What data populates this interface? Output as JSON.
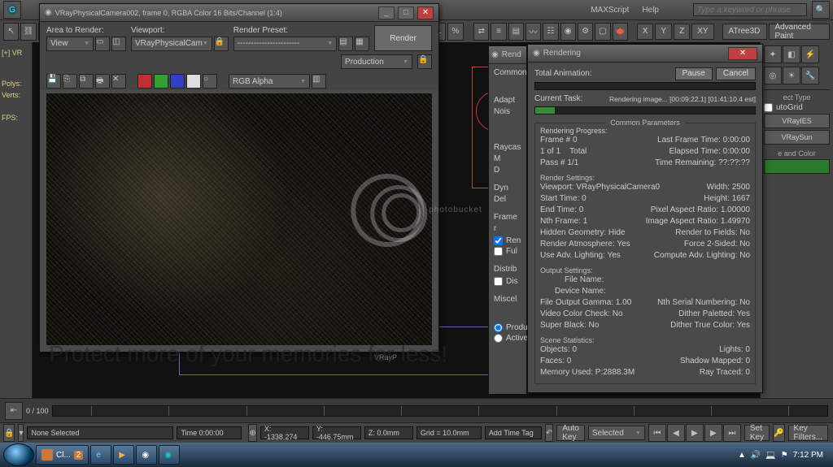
{
  "search_placeholder": "Type a keyword or phrase",
  "menu_items": [
    "MAXScript",
    "Help"
  ],
  "axis": [
    "X",
    "Y",
    "Z"
  ],
  "top_plugins": [
    "ATree3D",
    "Advanced Paint"
  ],
  "xyz_badge": "XY",
  "left": {
    "tab": "[+] VR",
    "polys": "Polys:",
    "verts": "Verts:",
    "fps": "FPS:"
  },
  "right": {
    "section1": "ect Type",
    "autogrid": "utoGrid",
    "btns": [
      "VRayIES",
      "VRaySun"
    ],
    "section2": "e and Color",
    "blank_btn": ""
  },
  "vfb": {
    "title": "VRayPhysicalCamera002, frame 0, RGBA Color 16 Bits/Channel (1:4)",
    "area_lbl": "Area to Render:",
    "area_val": "View",
    "viewport_lbl": "Viewport:",
    "viewport_val": "VRayPhysicalCam",
    "preset_lbl": "Render Preset:",
    "preset_val": "-----------------------",
    "render_btn": "Render",
    "prod_val": "Production",
    "channel": "RGB Alpha"
  },
  "sub": {
    "title": "Rend",
    "common": "Common",
    "adapt": "Adapt",
    "nois": "Nois",
    "raycas": "Raycas",
    "m": "M",
    "d": "D",
    "dyn": "Dyn",
    "del": "Del",
    "frame": "Frame r",
    "ren": "Ren",
    "ful": "Ful",
    "distrib": "Distrib",
    "dis": "Dis",
    "miscel": "Miscel",
    "produc": "Produc",
    "actives": "ActiveS"
  },
  "rend": {
    "title": "Rendering",
    "pause": "Pause",
    "cancel": "Cancel",
    "total_anim": "Total Animation:",
    "task_lbl": "Current Task:",
    "task_val": "Rendering image... [00:09:22.1] [01:41:10.4 est]",
    "common_params": "Common Parameters",
    "progress_lbl": "Rendering Progress:",
    "frame_no": "Frame # 0",
    "of": "1 of 1",
    "total": "Total",
    "pass": "Pass # 1/1",
    "lft": "Last Frame Time:  0:00:00",
    "elt": "Elapsed Time:  0:00:00",
    "trem": "Time Remaining:  ??:??:??",
    "rs_hdr": "Render Settings:",
    "rs": [
      [
        "Viewport:  VRayPhysicalCamera0",
        "Width: 2500"
      ],
      [
        "Start Time: 0",
        "Height: 1667"
      ],
      [
        "End Time: 0",
        "Pixel Aspect Ratio: 1.00000"
      ],
      [
        "Nth Frame: 1",
        "Image Aspect Ratio: 1.49970"
      ],
      [
        "Hidden Geometry: Hide",
        "Render to Fields: No"
      ],
      [
        "Render Atmosphere: Yes",
        "Force 2-Sided: No"
      ],
      [
        "Use Adv. Lighting: Yes",
        "Compute Adv. Lighting: No"
      ]
    ],
    "os_hdr": "Output Settings:",
    "os_file": "File Name:",
    "os_dev": "Device Name:",
    "os": [
      [
        "File Output Gamma:  1.00",
        "Nth Serial Numbering: No"
      ],
      [
        "Video Color Check: No",
        "Dither Paletted: Yes"
      ],
      [
        "Super Black: No",
        "Dither True Color: Yes"
      ]
    ],
    "ss_hdr": "Scene Statistics:",
    "ss": [
      [
        "Objects: 0",
        "Lights: 0"
      ],
      [
        "Faces: 0",
        "Shadow Mapped: 0"
      ],
      [
        "Memory Used: P:2888.3M",
        "Ray Traced: 0"
      ]
    ]
  },
  "viewport_label": "VRayP",
  "track": {
    "range": "0 / 100",
    "none": "None Selected",
    "time": "Time 0:00:00",
    "addtag": "Add Time Tag"
  },
  "status": {
    "x": "X: -1338.274",
    "y": "Y: -446.75mm",
    "z": "Z: 0.0mm",
    "grid": "Grid = 10.0mm",
    "autokey": "Auto Key",
    "selected": "Selected",
    "setkey": "Set Key",
    "keyfilters": "Key Filters..."
  },
  "taskbar": {
    "app1": "Cl...",
    "app1_badge": "2",
    "clock": "7:12 PM"
  },
  "watermark_text": "photobucket",
  "watermark2_text": "Protect more of your memories for less!"
}
